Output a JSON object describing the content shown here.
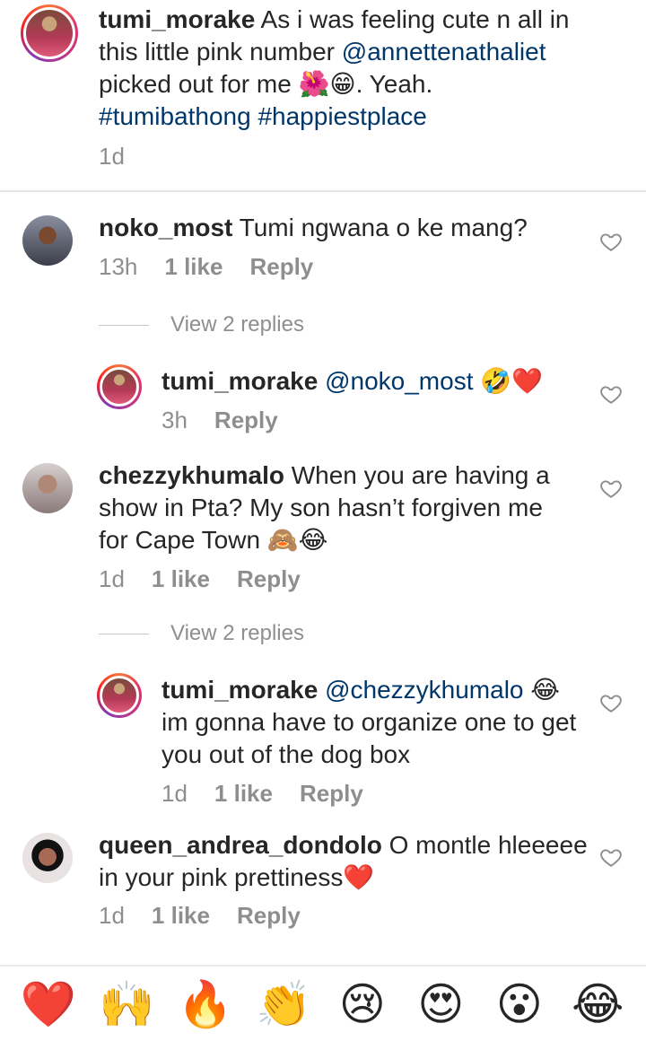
{
  "caption": {
    "username": "tumi_morake",
    "text_1": " As i was feeling cute n all in",
    "text_2": "this little pink number ",
    "mention": "@annettenathaliet",
    "text_3": "picked out for me ",
    "emoji": "🌺😁",
    "text_4": ". Yeah.",
    "hashtags": "#tumibathong #happiestplace",
    "time": "1d"
  },
  "comments": [
    {
      "username": "noko_most",
      "text": " Tumi ngwana o ke mang?",
      "time": "13h",
      "likes": "1 like",
      "reply": "Reply",
      "view_replies": "View 2 replies"
    },
    {
      "username": "tumi_morake",
      "mention": "@noko_most",
      "emoji": "🤣❤️",
      "time": "3h",
      "reply": "Reply"
    },
    {
      "username": "chezzykhumalo",
      "text_1": " When you are having a",
      "text_2": "show in Pta?  My son hasn’t forgiven me",
      "text_3": "for Cape Town ",
      "emoji": "🙈😂",
      "time": "1d",
      "likes": "1 like",
      "reply": "Reply",
      "view_replies": "View 2 replies"
    },
    {
      "username": "tumi_morake",
      "mention": "@chezzykhumalo",
      "emoji": "😂",
      "text_2": "im gonna have to organize one to get",
      "text_3": "you out of the dog box",
      "time": "1d",
      "likes": "1 like",
      "reply": "Reply"
    },
    {
      "username": "queen_andrea_dondolo",
      "text_1": " O montle hleeeee",
      "text_2": "in your pink prettiness",
      "emoji": "❤️",
      "time": "1d",
      "likes": "1 like",
      "reply": "Reply"
    }
  ],
  "reaction_bar": [
    "❤️",
    "🙌",
    "🔥",
    "👏",
    "😢",
    "😍",
    "😮",
    "😂"
  ]
}
